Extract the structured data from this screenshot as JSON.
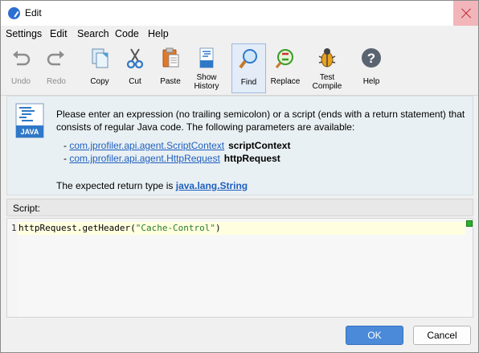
{
  "window": {
    "title": "Edit"
  },
  "menu": [
    "Settings",
    "Edit",
    "Search",
    "Code",
    "Help"
  ],
  "toolbar": {
    "undo": "Undo",
    "redo": "Redo",
    "copy": "Copy",
    "cut": "Cut",
    "paste": "Paste",
    "show_history_1": "Show",
    "show_history_2": "History",
    "find": "Find",
    "replace": "Replace",
    "test_compile_1": "Test",
    "test_compile_2": "Compile",
    "help": "Help"
  },
  "info": {
    "description_1": "Please enter an expression (no trailing semicolon) or a script (ends with a return statement) that",
    "description_2": "consists of regular Java code. The following parameters are available:",
    "params": [
      {
        "type": "com.jprofiler.api.agent.ScriptContext",
        "name": "scriptContext"
      },
      {
        "type": "com.jprofiler.api.agent.HttpRequest",
        "name": "httpRequest"
      }
    ],
    "return_prefix": "The expected return type is ",
    "return_type": "java.lang.String",
    "java_label": "JAVA"
  },
  "script": {
    "header": "Script:",
    "line_number": "1",
    "code_before": "httpRequest.getHeader(",
    "code_string": "\"Cache-Control\"",
    "code_after": ")"
  },
  "buttons": {
    "ok": "OK",
    "cancel": "Cancel"
  },
  "colors": {
    "accent": "#4a8ad8",
    "link": "#1f5fbf",
    "info_bg": "#e9f0f3",
    "status_ok": "#2bb02b"
  }
}
